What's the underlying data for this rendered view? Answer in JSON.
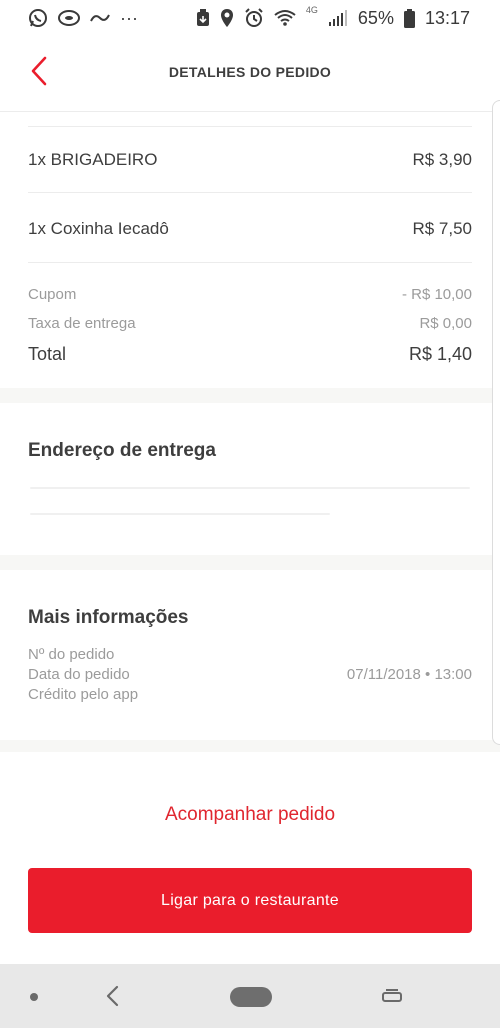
{
  "status_bar": {
    "battery": "65%",
    "time": "13:17",
    "network": "4G",
    "icons": [
      "whatsapp-icon",
      "chat-icon",
      "app-icon",
      "more-icon",
      "download-icon",
      "location-icon",
      "alarm-icon",
      "wifi-icon",
      "signal-icon",
      "battery-icon"
    ],
    "more": "···"
  },
  "header": {
    "title": "DETALHES DO PEDIDO",
    "back_icon": "chevron-left-icon"
  },
  "order": {
    "items": [
      {
        "qty_name": "1x BRIGADEIRO",
        "price": "R$ 3,90"
      },
      {
        "qty_name": "1x Coxinha Iecadô",
        "price": "R$ 7,50"
      }
    ],
    "coupon_label": "Cupom",
    "coupon_value": "- R$ 10,00",
    "delivery_label": "Taxa de entrega",
    "delivery_value": "R$ 0,00",
    "total_label": "Total",
    "total_value": "R$ 1,40"
  },
  "address": {
    "title": "Endereço de entrega"
  },
  "more_info": {
    "title": "Mais informações",
    "order_number_label": "Nº do pedido",
    "order_date_label": "Data do pedido",
    "order_date_value": "07/11/2018 • 13:00",
    "app_credit_label": "Crédito pelo app"
  },
  "actions": {
    "track_label": "Acompanhar pedido",
    "call_label": "Ligar para o restaurante"
  },
  "colors": {
    "accent": "#ea1d2c",
    "muted_text": "#9b9b9b",
    "primary_text": "#3e3e3e"
  }
}
